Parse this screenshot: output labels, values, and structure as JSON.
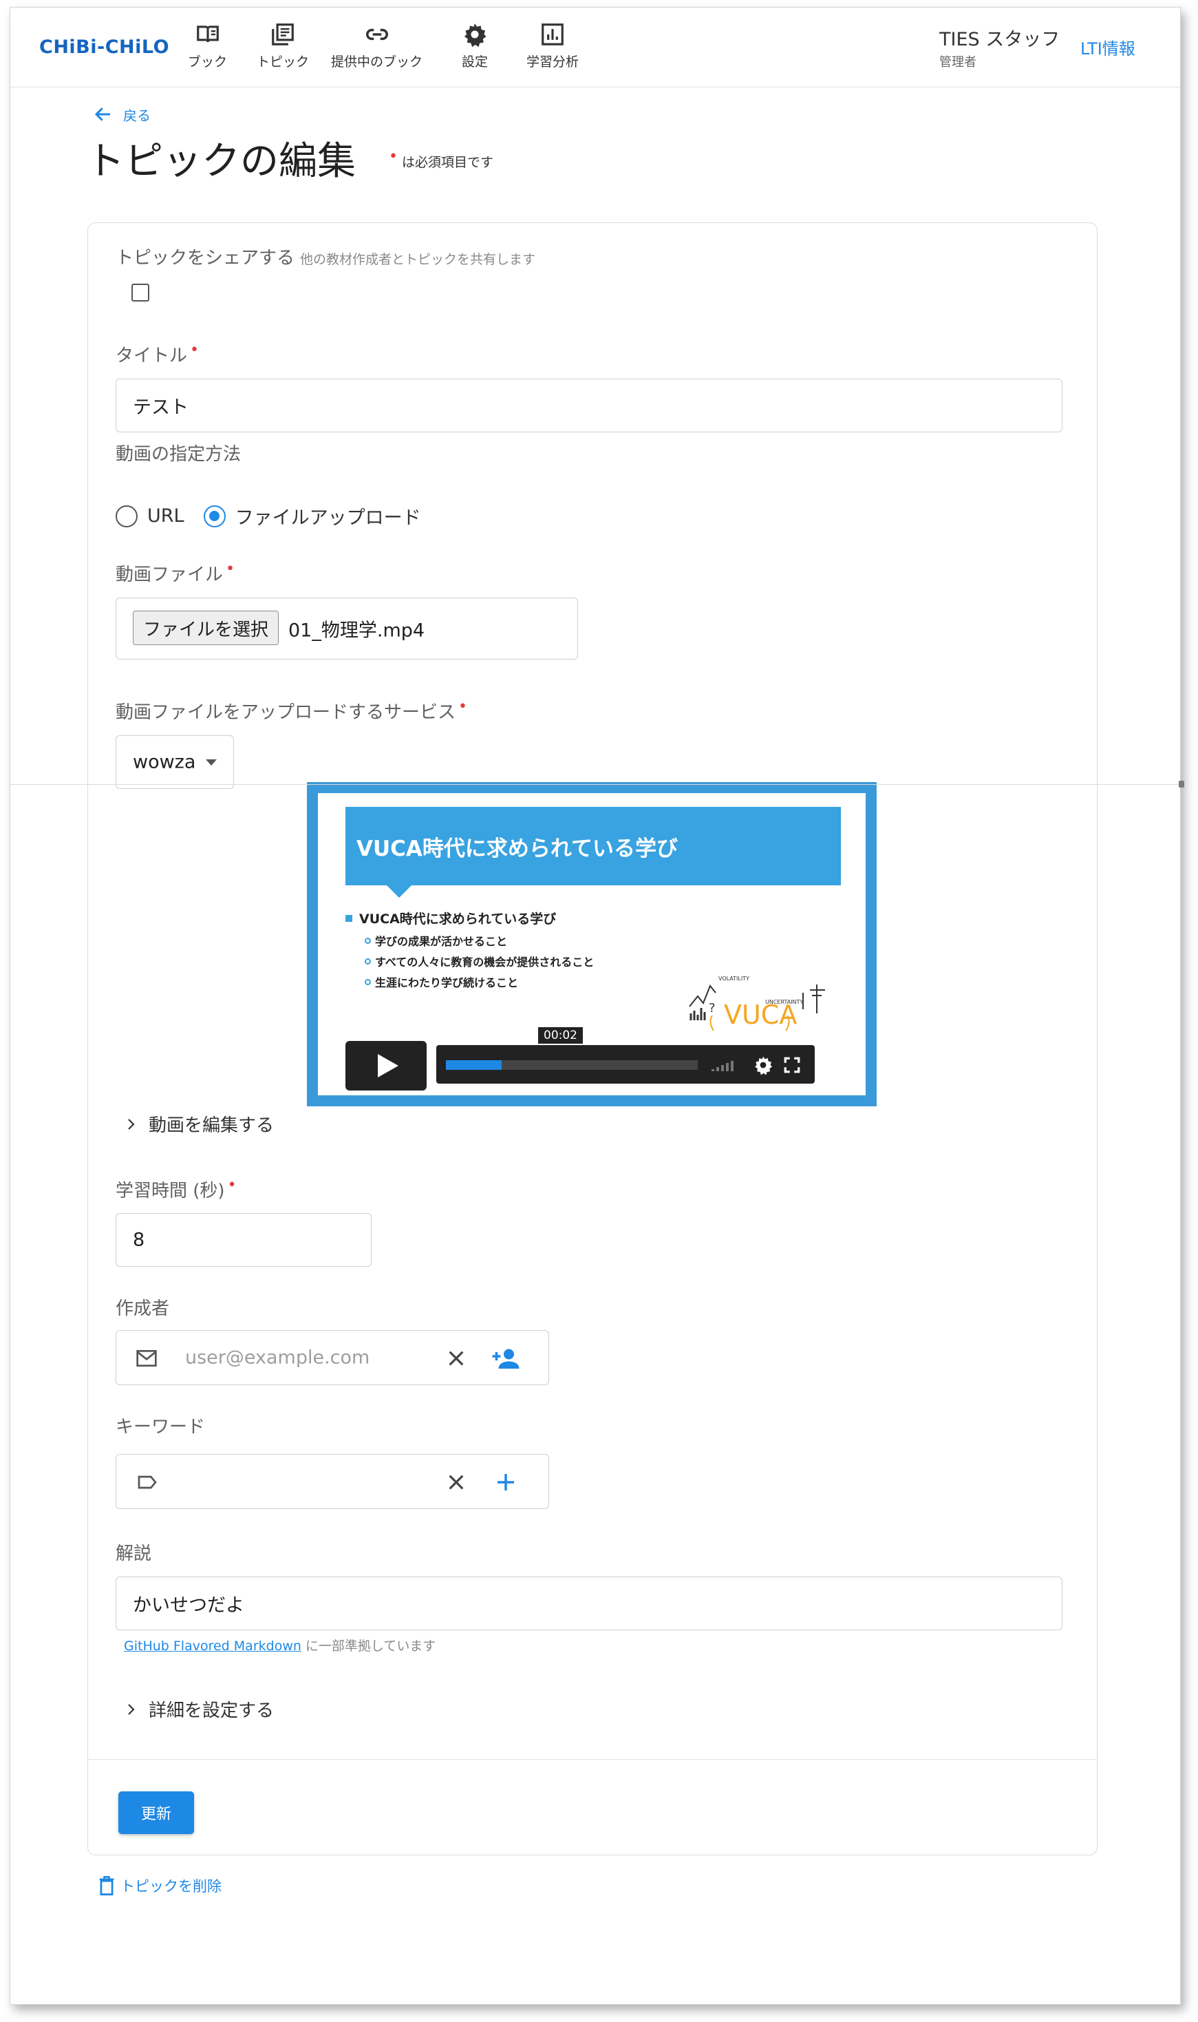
{
  "app": {
    "logo": "CHiBi-CHiLO"
  },
  "nav": [
    {
      "label": "ブック",
      "icon": "book-icon"
    },
    {
      "label": "トピック",
      "icon": "topic-icon"
    },
    {
      "label": "提供中のブック",
      "icon": "link-icon"
    },
    {
      "label": "設定",
      "icon": "gear-icon"
    },
    {
      "label": "学習分析",
      "icon": "analytics-icon"
    }
  ],
  "user": {
    "name": "TIES スタッフ",
    "role": "管理者",
    "lti_link": "LTI情報"
  },
  "page": {
    "back": "戻る",
    "title": "トピックの編集",
    "required_note": "は必須項目です"
  },
  "form": {
    "share": {
      "label": "トピックをシェアする",
      "help": "他の教材作成者とトピックを共有します",
      "checked": false
    },
    "title": {
      "label": "タイトル",
      "value": "テスト"
    },
    "video_method": {
      "label": "動画の指定方法",
      "options": [
        "URL",
        "ファイルアップロード"
      ],
      "selected": "ファイルアップロード"
    },
    "video_file": {
      "label": "動画ファイル",
      "button": "ファイルを選択",
      "filename": "01_物理学.mp4"
    },
    "upload_service": {
      "label": "動画ファイルをアップロードするサービス",
      "value": "wowza"
    },
    "video_preview": {
      "slide_title": "VUCA時代に求められている学び",
      "slide_heading": "VUCA時代に求められている学び",
      "slide_bullets": [
        "学びの成果が活かせること",
        "すべての人々に教育の機会が提供されること",
        "生涯にわたり学び続けること"
      ],
      "graphic_text": "VUCA",
      "graphic_small_labels": [
        "VOLATILITY",
        "UNCERTAINTY"
      ],
      "time": "00:02",
      "progress": 0.22
    },
    "edit_video": "動画を編集する",
    "study_time": {
      "label": "学習時間 (秒)",
      "value": "8"
    },
    "author": {
      "label": "作成者",
      "placeholder": "user@example.com"
    },
    "keyword": {
      "label": "キーワード",
      "value": ""
    },
    "description": {
      "label": "解説",
      "value": "かいせつだよ",
      "note_link": "GitHub Flavored Markdown",
      "note_text": "に一部準拠しています"
    },
    "advanced": "詳細を設定する",
    "submit": "更新"
  },
  "delete": "トピックを削除",
  "colors": {
    "accent": "#1e88e5",
    "required": "#e53935",
    "brand": "#1565c0",
    "video_frame": "#3a9ad9",
    "vuca": "#f5a623"
  }
}
